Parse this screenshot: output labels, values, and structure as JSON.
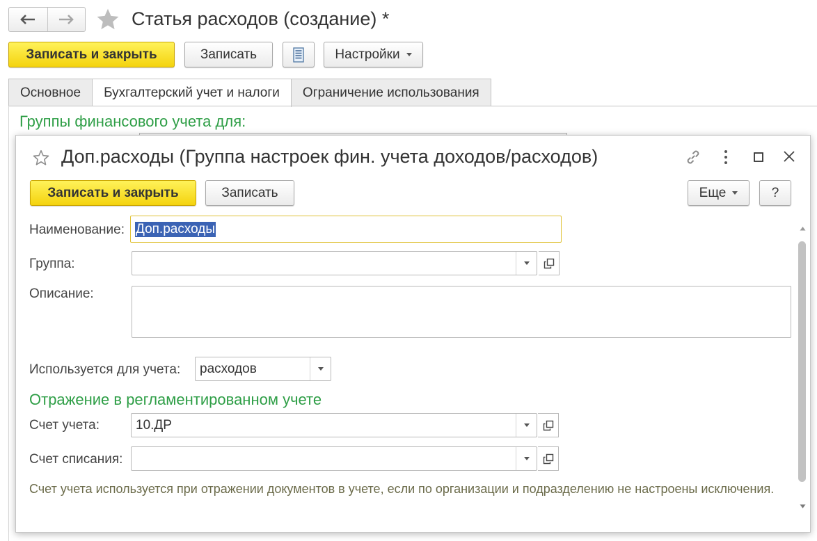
{
  "window": {
    "title": "Статья расходов (создание) *",
    "nav": {
      "back_icon": "arrow-left-icon",
      "forward_icon": "arrow-right-icon"
    },
    "toolbar": {
      "save_close_label": "Записать и закрыть",
      "save_label": "Записать",
      "settings_label": "Настройки"
    },
    "tabs": [
      {
        "label": "Основное"
      },
      {
        "label": "Бухгалтерский учет и налоги",
        "active": true
      },
      {
        "label": "Ограничение использования"
      }
    ],
    "section_heading": "Группы финансового учета для:"
  },
  "dialog": {
    "title": "Доп.расходы (Группа настроек фин. учета доходов/расходов)",
    "toolbar": {
      "save_close_label": "Записать и закрыть",
      "save_label": "Записать",
      "more_label": "Еще",
      "help_label": "?"
    },
    "fields": {
      "name_label": "Наименование:",
      "name_value": "Доп.расходы",
      "group_label": "Группа:",
      "group_value": "",
      "description_label": "Описание:",
      "description_value": "",
      "used_for_label": "Используется для учета:",
      "used_for_value": "расходов"
    },
    "reg_section": {
      "heading": "Отражение в регламентированном учете",
      "account_label": "Счет учета:",
      "account_value": "10.ДР",
      "writeoff_label": "Счет списания:",
      "writeoff_value": "",
      "hint": "Счет учета используется при отражении документов в учете, если по организации и подразделению не настроены исключения."
    }
  },
  "colors": {
    "accent_yellow": "#f4d30e",
    "section_green": "#2e9e46",
    "selection_blue": "#3b63b4",
    "focus_border": "#e0c236"
  }
}
